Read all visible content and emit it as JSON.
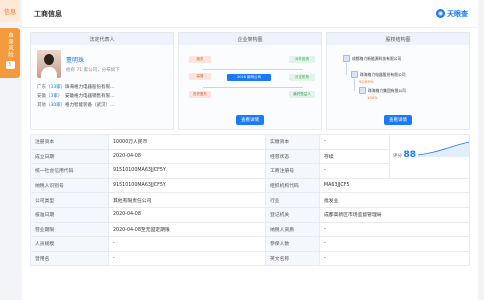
{
  "side_tabs": {
    "top": "信息",
    "active": "自身风险",
    "active_count": "5"
  },
  "card": {
    "title": "工商信息",
    "brand": "天眼查",
    "brand_icon": "eye-icon"
  },
  "panels": {
    "legal": {
      "title": "法定代表人",
      "name": "董明珠",
      "sub_prefix": "他有",
      "sub_count": "71",
      "sub_suffix": "家公司，分布如下",
      "relations": [
        {
          "region": "广东",
          "count": "33家",
          "company": "珠海格力电器股份有限..."
        },
        {
          "region": "安徽",
          "count": "3家",
          "company": "安徽格力电器销售有限..."
        },
        {
          "region": "其他",
          "count": "30家",
          "company": "格力智能装备（武汉）..."
        }
      ],
      "button": "查看详情"
    },
    "structure": {
      "title": "企业架构图",
      "boxes": [
        "股东",
        "对外投资",
        "高管",
        "历史股东",
        "2018 新网公司",
        "分支机构",
        "最终受益人"
      ],
      "button": "查看详情"
    },
    "equity": {
      "title": "股权结构图",
      "items": [
        "成都格力新能源科技有限公司",
        "珠海格力电器股份有限公司",
        "92.85%",
        "珠海格力集团有限公司",
        "100%"
      ],
      "button": "查看详情"
    }
  },
  "info_rows": [
    [
      "注册资本",
      "10000万人民币",
      "实缴资本",
      "-"
    ],
    [
      "成立日期",
      "2020-04-08",
      "经营状态",
      "存续"
    ],
    [
      "统一社会信用代码",
      "91510100MA63JJCF5Y",
      "工商注册号",
      "-"
    ],
    [
      "纳税人识别号",
      "91510100MA63JJCF5Y",
      "组织机构代码",
      "MA63JJCF5"
    ],
    [
      "公司类型",
      "其他有限责任公司",
      "行业",
      "批发业"
    ],
    [
      "核准日期",
      "2020-04-08",
      "登记机关",
      "成都高新区市场监督管理局"
    ],
    [
      "营业期限",
      "2020-04-08至无固定期限",
      "纳税人资质",
      "-"
    ],
    [
      "人员规模",
      "-",
      "参保人数",
      "-"
    ],
    [
      "曾用名",
      "-",
      "英文名称",
      "-"
    ]
  ],
  "score": {
    "label": "评分",
    "value": "88"
  },
  "colors": {
    "accent": "#1a7af8",
    "side_active": "#f39a3c"
  }
}
